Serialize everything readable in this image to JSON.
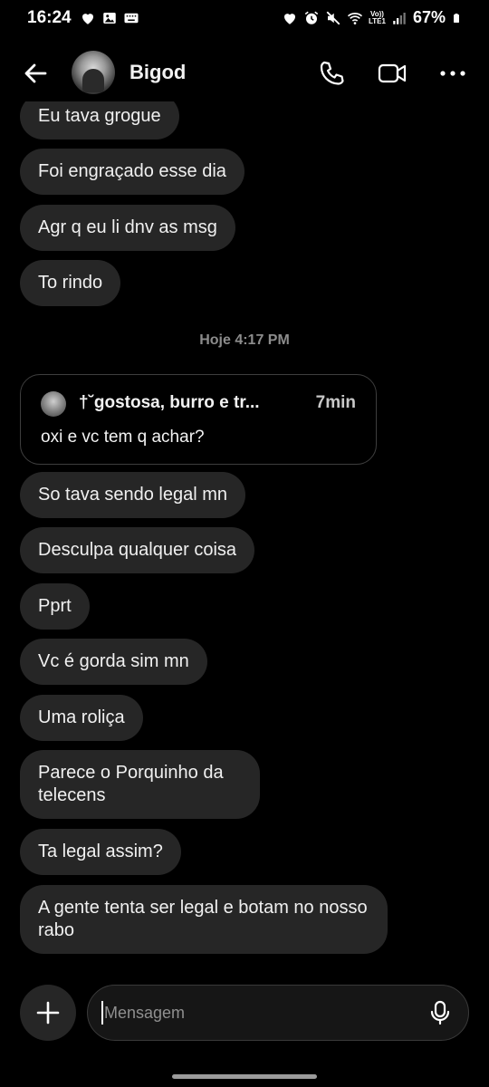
{
  "status_bar": {
    "time": "16:24",
    "battery": "67%",
    "left_icons": [
      "heart-icon",
      "gallery-icon",
      "keyboard-icon"
    ],
    "right_icons": [
      "heart-icon",
      "alarm-icon",
      "mute-icon",
      "wifi-icon",
      "volte-icon",
      "signal-icon",
      "battery-icon"
    ],
    "volte_top": "Vo))",
    "volte_bottom": "LTE1"
  },
  "header": {
    "contact_name": "Bigod",
    "icons": [
      "back-arrow-icon",
      "phone-icon",
      "video-icon",
      "more-icon"
    ]
  },
  "messages_before": [
    "Eu tava grogue",
    "Foi engraçado esse dia",
    "Agr q eu li dnv as msg",
    "To rindo"
  ],
  "timestamp": "Hoje 4:17 PM",
  "reply": {
    "author": "†˘gostosa, burro e tr...",
    "time": "7min",
    "text": "oxi e vc tem q achar?"
  },
  "messages_after": [
    "So tava sendo legal mn",
    "Desculpa qualquer coisa",
    "Pprt",
    "Vc é gorda sim mn",
    "Uma roliça",
    "Parece o Porquinho da telecens",
    "Ta legal assim?",
    "A gente tenta ser legal e botam no nosso rabo"
  ],
  "composer": {
    "placeholder": "Mensagem",
    "icons": [
      "plus-icon",
      "microphone-icon"
    ]
  },
  "colors": {
    "background": "#000000",
    "bubble": "#262626",
    "timestamp": "#8c8c8c"
  }
}
